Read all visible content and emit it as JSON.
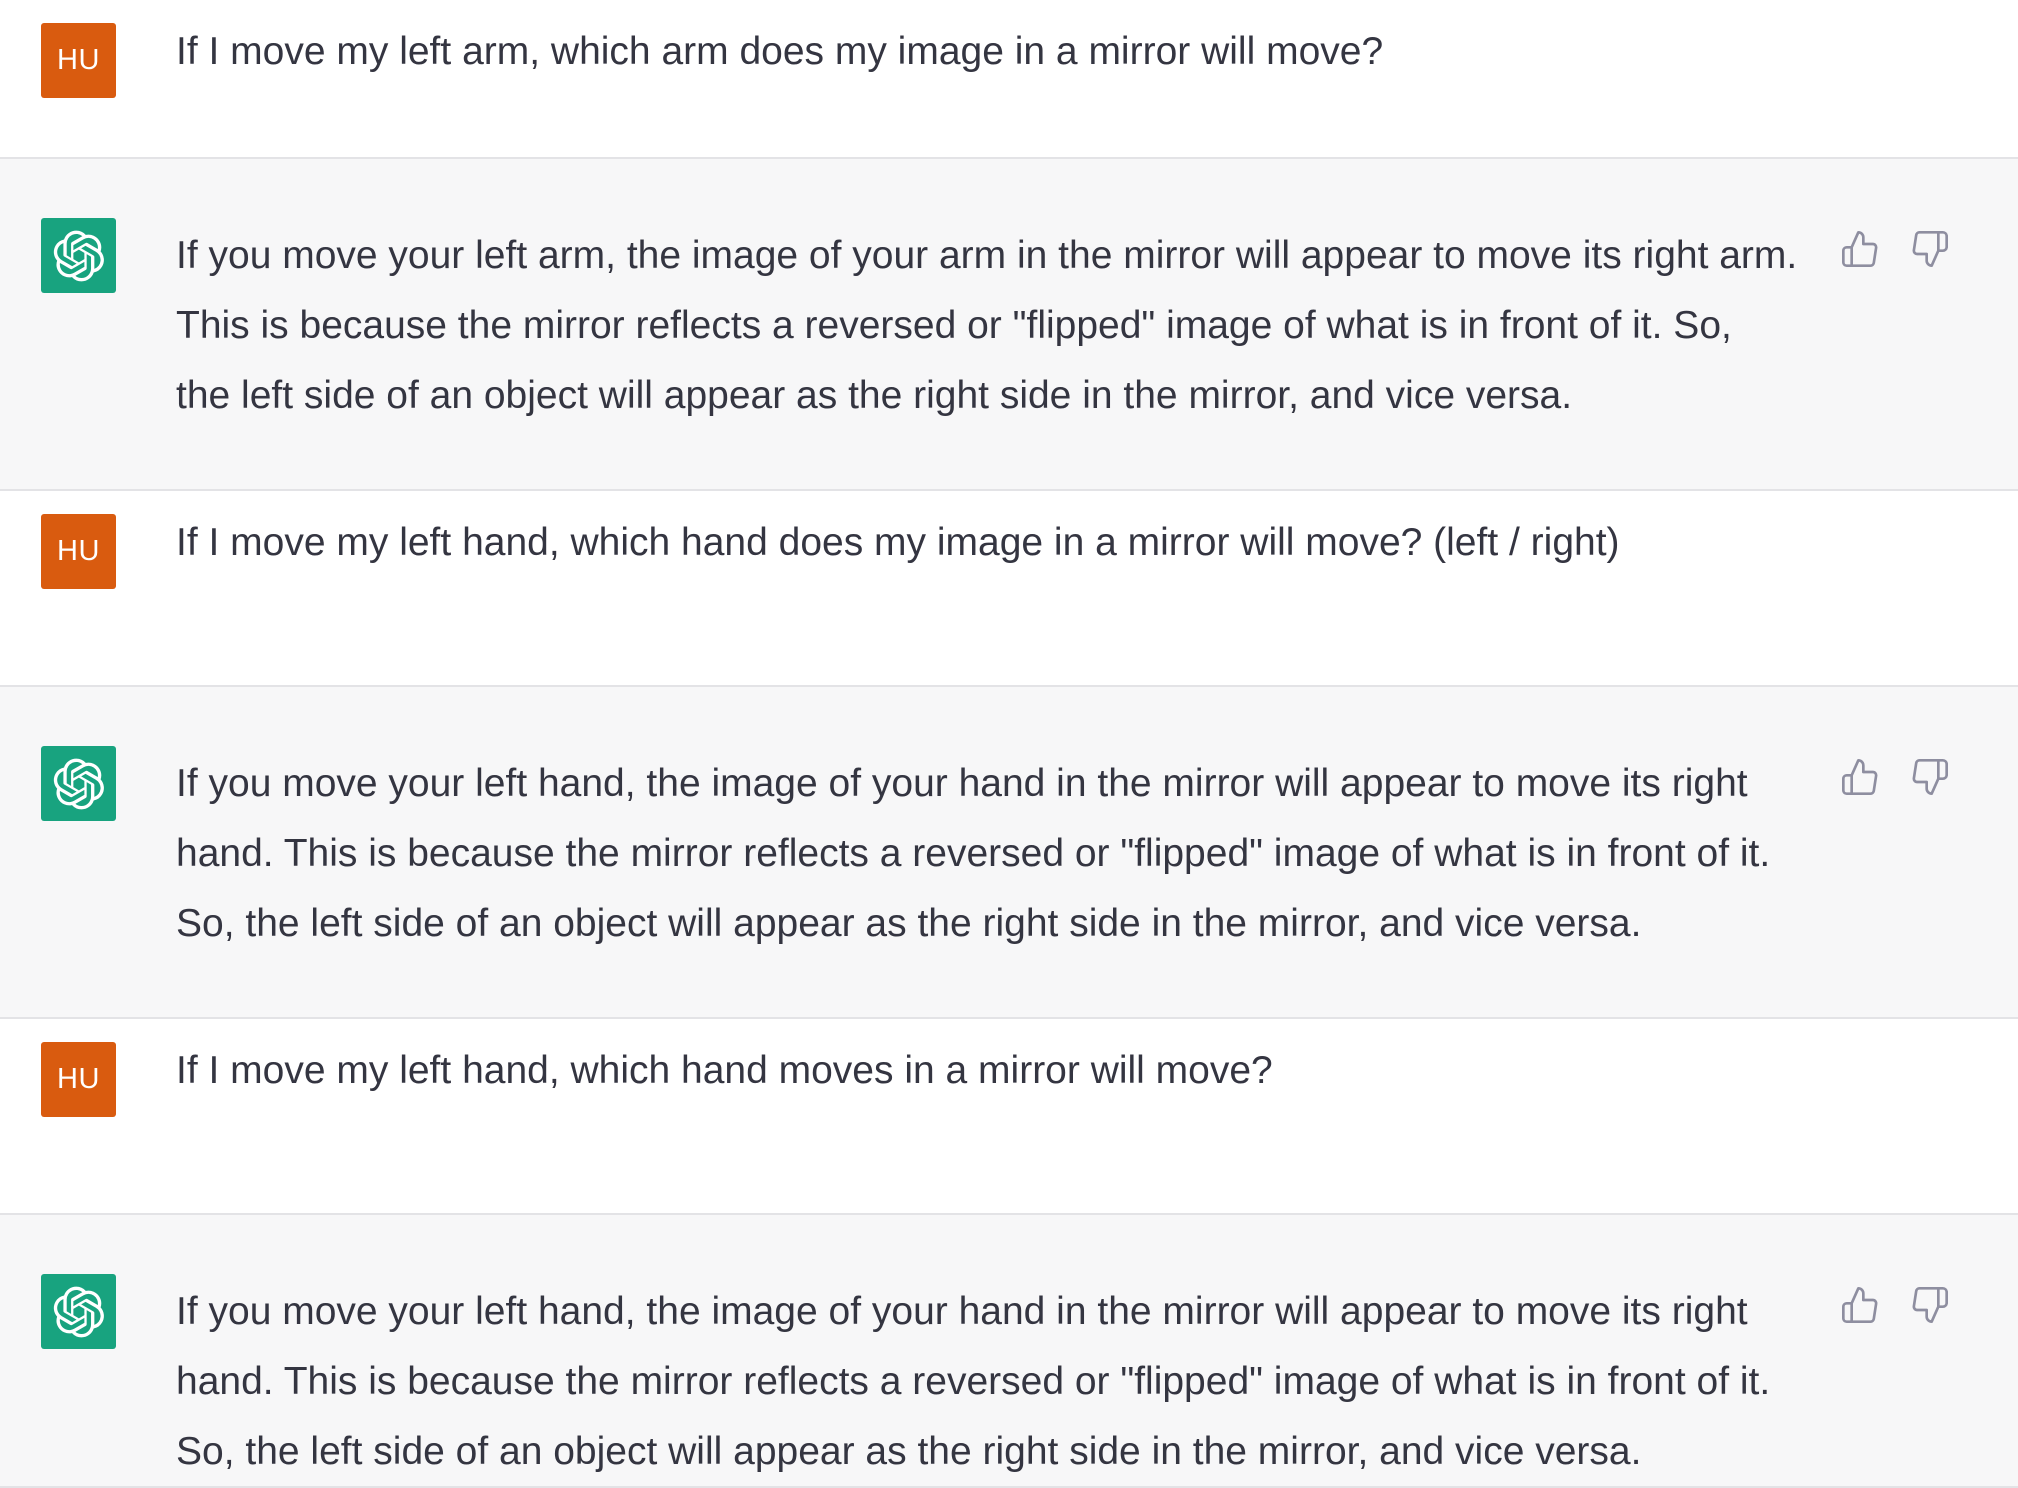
{
  "conversation": {
    "messages": [
      {
        "role": "user",
        "avatar_label": "HU",
        "text": "If I move my left arm, which arm does my image in a mirror will move?"
      },
      {
        "role": "assistant",
        "avatar_icon": "openai-logo-icon",
        "lines": [
          "If you move your left arm, the image of your arm in the mirror will appear to move its right arm.",
          "This is because the mirror reflects a reversed or \"flipped\" image of what is in front of it. So,",
          "the left side of an object will appear as the right side in the mirror, and vice versa."
        ]
      },
      {
        "role": "user",
        "avatar_label": "HU",
        "text": "If I move my left hand, which hand does my image in a mirror will move? (left / right)"
      },
      {
        "role": "assistant",
        "avatar_icon": "openai-logo-icon",
        "lines": [
          "If you move your left hand, the image of your hand in the mirror will appear to move its right",
          "hand. This is because the mirror reflects a reversed or \"flipped\" image of what is in front of it.",
          "So, the left side of an object will appear as the right side in the mirror, and vice versa."
        ]
      },
      {
        "role": "user",
        "avatar_label": "HU",
        "text": "If I move my left hand, which hand moves in a mirror will move?"
      },
      {
        "role": "assistant",
        "avatar_icon": "openai-logo-icon",
        "lines": [
          "If you move your left hand, the image of your hand in the mirror will appear to move its right",
          "hand. This is because the mirror reflects a reversed or \"flipped\" image of what is in front of it.",
          "So, the left side of an object will appear as the right side in the mirror, and vice versa."
        ]
      }
    ]
  },
  "colors": {
    "user_avatar": "#d95b0f",
    "assistant_avatar": "#18a37f",
    "assistant_bg": "#f7f7f8",
    "user_bg": "#ffffff",
    "text": "#343541",
    "icon": "#8e8ea0"
  }
}
